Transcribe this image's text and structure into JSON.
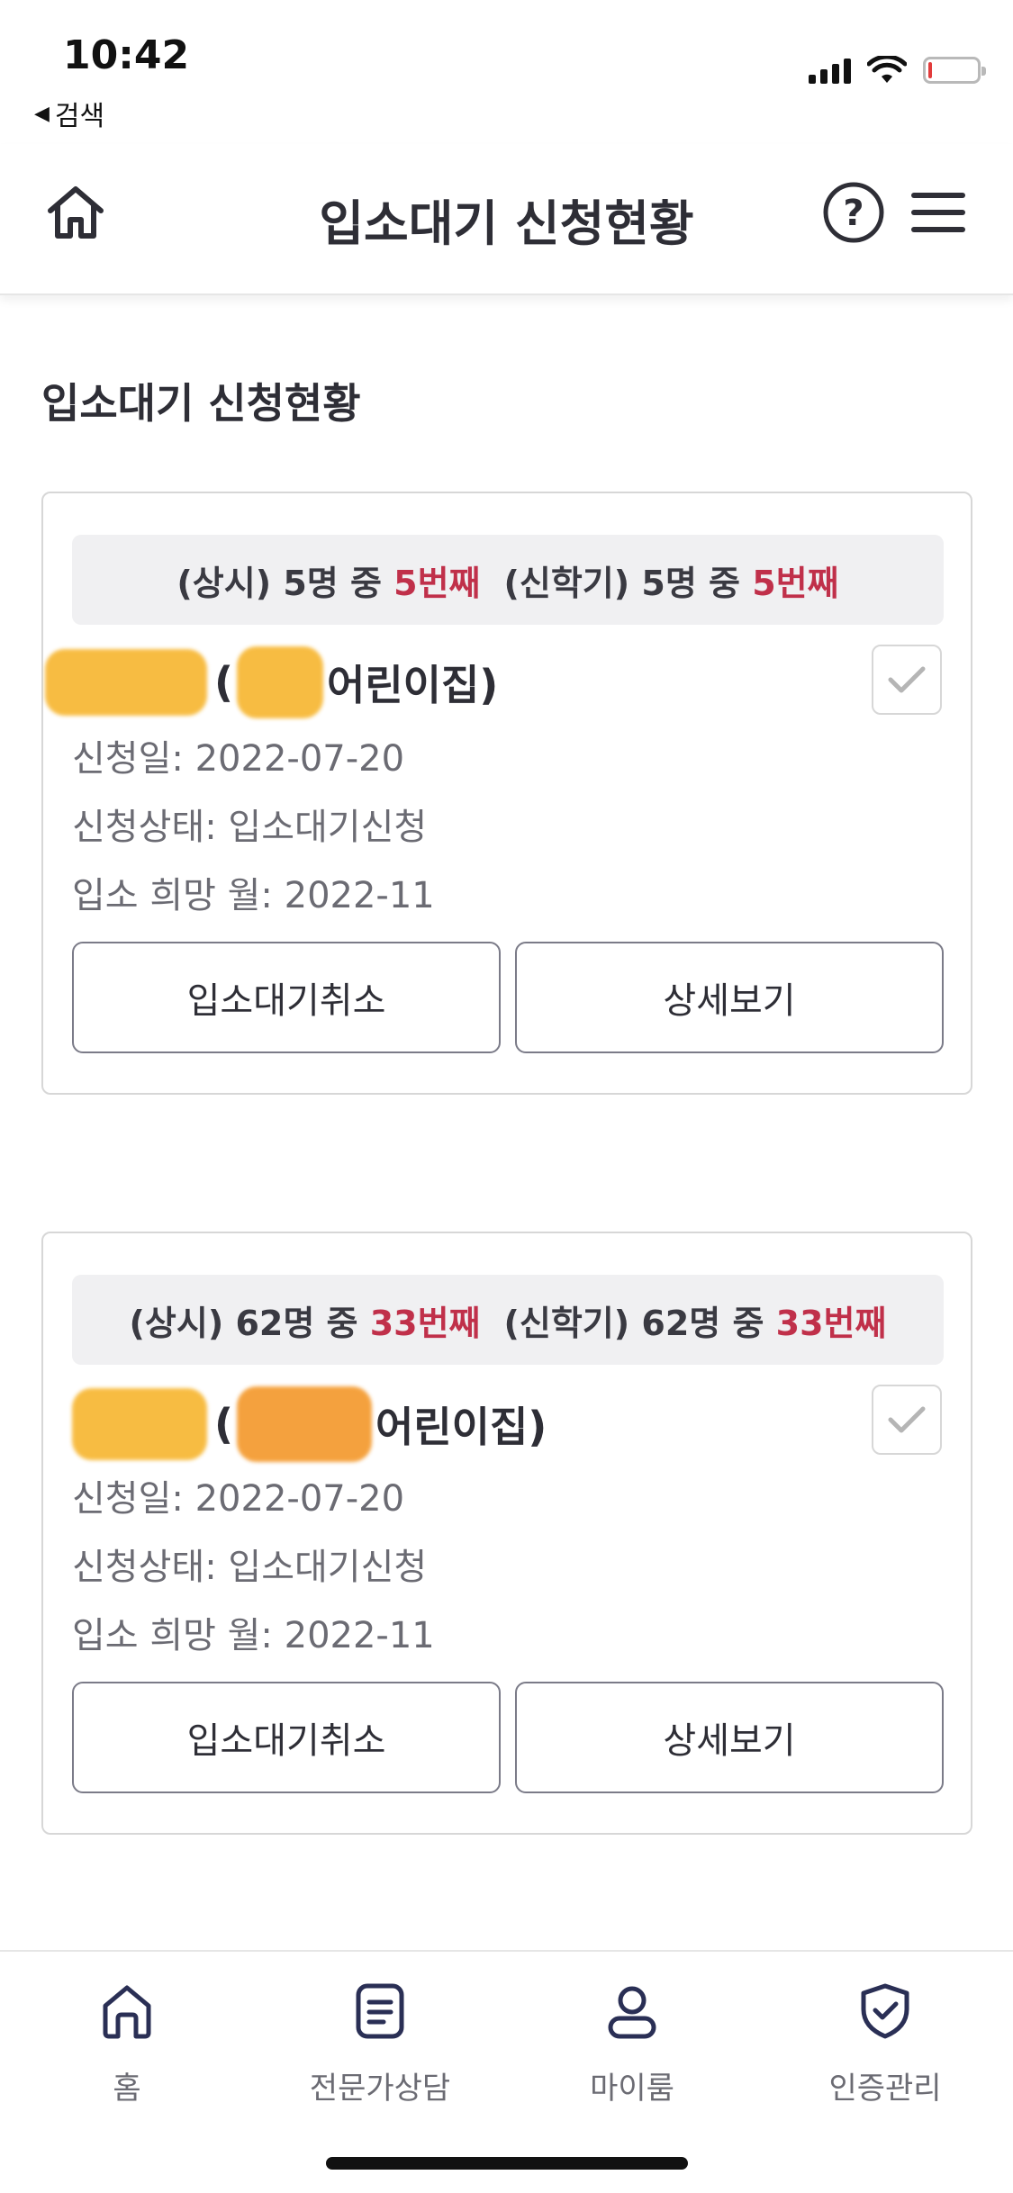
{
  "status_bar": {
    "time": "10:42",
    "back_label": "검색",
    "icons": [
      "cellular-signal-icon",
      "wifi-icon",
      "battery-icon"
    ],
    "battery_level": 0.08,
    "battery_color": "#e23b3b"
  },
  "header": {
    "title": "입소대기 신청현황",
    "icons": [
      "home-icon",
      "help-icon",
      "menu-icon"
    ]
  },
  "section_title": "입소대기 신청현황",
  "colors": {
    "accent_red": "#c0304a",
    "text_dark": "#2e2e36",
    "text_gray": "#6b6b73",
    "banner_bg": "#f0f0f2",
    "redaction": "#f7b733"
  },
  "applications": [
    {
      "regular_label": "(상시)",
      "regular_total": "5명 중",
      "regular_rank": "5번째",
      "semester_label": "(신학기)",
      "semester_total": "5명 중",
      "semester_rank": "5번째",
      "name_open": "(",
      "name_suffix": "어린이집)",
      "apply_date": "신청일: 2022-07-20",
      "apply_status": "신청상태: 입소대기신청",
      "desired_month": "입소 희망 월: 2022-11",
      "cancel_label": "입소대기취소",
      "detail_label": "상세보기",
      "checked": true
    },
    {
      "regular_label": "(상시)",
      "regular_total": "62명 중",
      "regular_rank": "33번째",
      "semester_label": "(신학기)",
      "semester_total": "62명 중",
      "semester_rank": "33번째",
      "name_open": "(",
      "name_suffix": "어린이집)",
      "apply_date": "신청일: 2022-07-20",
      "apply_status": "신청상태: 입소대기신청",
      "desired_month": "입소 희망 월: 2022-11",
      "cancel_label": "입소대기취소",
      "detail_label": "상세보기",
      "checked": true
    }
  ],
  "tab_bar": {
    "tabs": [
      {
        "label": "홈",
        "icon": "home-outline-icon"
      },
      {
        "label": "전문가상담",
        "icon": "document-icon"
      },
      {
        "label": "마이룸",
        "icon": "person-icon"
      },
      {
        "label": "인증관리",
        "icon": "shield-check-icon"
      }
    ]
  }
}
